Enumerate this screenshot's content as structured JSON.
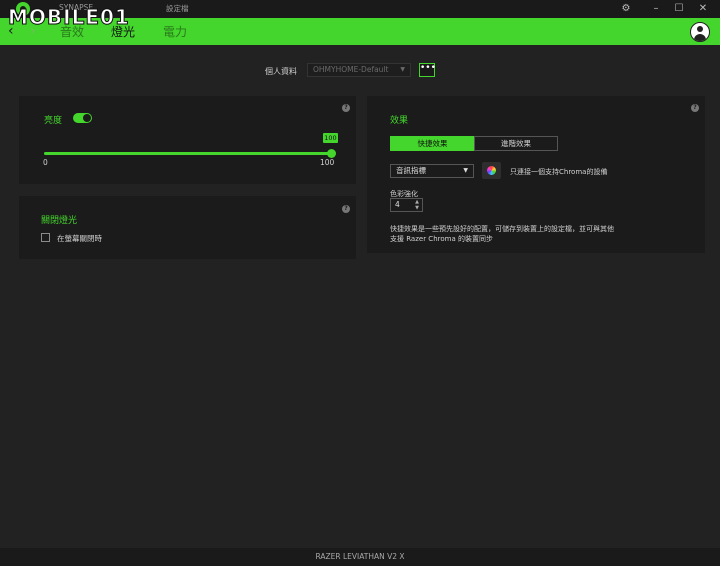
{
  "watermark": "MOBILE01",
  "titlebar": {
    "tabs": [
      "SYNAPSE",
      "設定檔"
    ],
    "controls": [
      "gear-icon",
      "minimize-icon",
      "maximize-icon",
      "close-icon"
    ]
  },
  "nav": {
    "tabs": [
      "音效",
      "燈光",
      "電力"
    ],
    "active_tab": "燈光"
  },
  "profile": {
    "label": "個人資料",
    "value": "OHMYHOME-Default",
    "more": "•••"
  },
  "brightness": {
    "title": "亮度",
    "enabled": true,
    "value": "100",
    "level": 100,
    "min_label": "0",
    "max_label": "100"
  },
  "lighting_off": {
    "title": "關閉燈光",
    "option_label": "在螢幕關閉時",
    "checked": false
  },
  "effects": {
    "title": "效果",
    "tabs": [
      "快捷效果",
      "進階效果"
    ],
    "active_tab": "快捷效果",
    "effect_value": "音訊指標",
    "chroma_note": "只連接一個支持Chroma的設備",
    "saturation_label": "色彩強化",
    "saturation_value": "4",
    "description_line1": "快捷效果是一些預先設好的配置，可儲存到裝置上的設定檔，並可與其他",
    "description_line2": "支援 Razer Chroma 的裝置同步"
  },
  "footer": {
    "device_name": "RAZER LEVIATHAN V2 X"
  },
  "colors": {
    "accent": "#44d62c",
    "panel": "#1b1b1b",
    "background": "#222222"
  }
}
